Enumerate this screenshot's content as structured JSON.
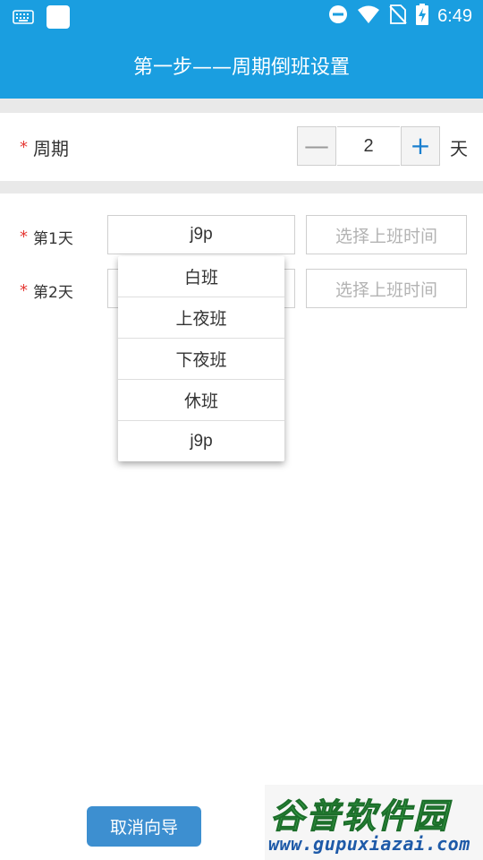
{
  "status_bar": {
    "time": "6:49",
    "icons": [
      "keyboard-icon",
      "app-square-icon",
      "do-not-disturb-icon",
      "wifi-icon",
      "no-sim-icon",
      "battery-charging-icon"
    ]
  },
  "app_bar": {
    "title": "第一步——周期倒班设置"
  },
  "cycle": {
    "required_mark": "*",
    "label": "周期",
    "minus_symbol": "—",
    "value": "2",
    "plus_symbol": "+",
    "unit": "天"
  },
  "days": [
    {
      "required_mark": "*",
      "label": "第1天",
      "shift": "j9p",
      "time_placeholder": "选择上班时间"
    },
    {
      "required_mark": "*",
      "label": "第2天",
      "shift": "",
      "time_placeholder": "选择上班时间"
    }
  ],
  "dropdown": {
    "options": [
      "白班",
      "上夜班",
      "下夜班",
      "休班",
      "j9p"
    ]
  },
  "footer": {
    "cancel_label": "取消向导"
  },
  "watermark": {
    "title": "谷普软件园",
    "url": "www.gupuxiazai.com"
  },
  "colors": {
    "primary": "#1a9ee0",
    "button": "#3d8fd0",
    "required": "#e53935",
    "placeholder": "#b3b3b3"
  }
}
